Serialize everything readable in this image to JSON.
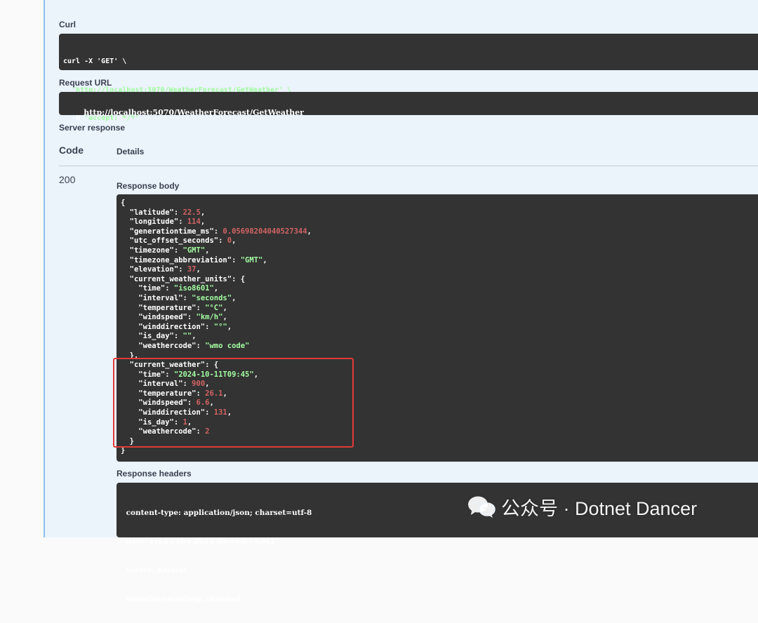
{
  "curl": {
    "label": "Curl",
    "lines": [
      "curl -X 'GET' \\",
      "  'http://localhost:5070/WeatherForecast/GetWeather' \\",
      "  -H 'accept: */*'"
    ]
  },
  "request_url": {
    "label": "Request URL",
    "value": "http://localhost:5070/WeatherForecast/GetWeather"
  },
  "server_response": {
    "label": "Server response",
    "col_code": "Code",
    "col_details": "Details",
    "status_code": "200",
    "body_label": "Response body",
    "body_lines": [
      [
        [
          "p",
          "{"
        ]
      ],
      [
        [
          "p",
          "  "
        ],
        [
          "k",
          "\"latitude\""
        ],
        [
          "p",
          ": "
        ],
        [
          "n",
          "22.5"
        ],
        [
          "p",
          ","
        ]
      ],
      [
        [
          "p",
          "  "
        ],
        [
          "k",
          "\"longitude\""
        ],
        [
          "p",
          ": "
        ],
        [
          "n",
          "114"
        ],
        [
          "p",
          ","
        ]
      ],
      [
        [
          "p",
          "  "
        ],
        [
          "k",
          "\"generationtime_ms\""
        ],
        [
          "p",
          ": "
        ],
        [
          "n",
          "0.05698204040527344"
        ],
        [
          "p",
          ","
        ]
      ],
      [
        [
          "p",
          "  "
        ],
        [
          "k",
          "\"utc_offset_seconds\""
        ],
        [
          "p",
          ": "
        ],
        [
          "n",
          "0"
        ],
        [
          "p",
          ","
        ]
      ],
      [
        [
          "p",
          "  "
        ],
        [
          "k",
          "\"timezone\""
        ],
        [
          "p",
          ": "
        ],
        [
          "s",
          "\"GMT\""
        ],
        [
          "p",
          ","
        ]
      ],
      [
        [
          "p",
          "  "
        ],
        [
          "k",
          "\"timezone_abbreviation\""
        ],
        [
          "p",
          ": "
        ],
        [
          "s",
          "\"GMT\""
        ],
        [
          "p",
          ","
        ]
      ],
      [
        [
          "p",
          "  "
        ],
        [
          "k",
          "\"elevation\""
        ],
        [
          "p",
          ": "
        ],
        [
          "n",
          "37"
        ],
        [
          "p",
          ","
        ]
      ],
      [
        [
          "p",
          "  "
        ],
        [
          "k",
          "\"current_weather_units\""
        ],
        [
          "p",
          ": {"
        ]
      ],
      [
        [
          "p",
          "    "
        ],
        [
          "k",
          "\"time\""
        ],
        [
          "p",
          ": "
        ],
        [
          "s",
          "\"iso8601\""
        ],
        [
          "p",
          ","
        ]
      ],
      [
        [
          "p",
          "    "
        ],
        [
          "k",
          "\"interval\""
        ],
        [
          "p",
          ": "
        ],
        [
          "s",
          "\"seconds\""
        ],
        [
          "p",
          ","
        ]
      ],
      [
        [
          "p",
          "    "
        ],
        [
          "k",
          "\"temperature\""
        ],
        [
          "p",
          ": "
        ],
        [
          "s",
          "\"°C\""
        ],
        [
          "p",
          ","
        ]
      ],
      [
        [
          "p",
          "    "
        ],
        [
          "k",
          "\"windspeed\""
        ],
        [
          "p",
          ": "
        ],
        [
          "s",
          "\"km/h\""
        ],
        [
          "p",
          ","
        ]
      ],
      [
        [
          "p",
          "    "
        ],
        [
          "k",
          "\"winddirection\""
        ],
        [
          "p",
          ": "
        ],
        [
          "s",
          "\"°\""
        ],
        [
          "p",
          ","
        ]
      ],
      [
        [
          "p",
          "    "
        ],
        [
          "k",
          "\"is_day\""
        ],
        [
          "p",
          ": "
        ],
        [
          "s",
          "\"\""
        ],
        [
          "p",
          ","
        ]
      ],
      [
        [
          "p",
          "    "
        ],
        [
          "k",
          "\"weathercode\""
        ],
        [
          "p",
          ": "
        ],
        [
          "s",
          "\"wmo code\""
        ]
      ],
      [
        [
          "p",
          "  },"
        ]
      ],
      [
        [
          "p",
          "  "
        ],
        [
          "k",
          "\"current_weather\""
        ],
        [
          "p",
          ": {"
        ]
      ],
      [
        [
          "p",
          "    "
        ],
        [
          "k",
          "\"time\""
        ],
        [
          "p",
          ": "
        ],
        [
          "s",
          "\"2024-10-11T09:45\""
        ],
        [
          "p",
          ","
        ]
      ],
      [
        [
          "p",
          "    "
        ],
        [
          "k",
          "\"interval\""
        ],
        [
          "p",
          ": "
        ],
        [
          "n",
          "900"
        ],
        [
          "p",
          ","
        ]
      ],
      [
        [
          "p",
          "    "
        ],
        [
          "k",
          "\"temperature\""
        ],
        [
          "p",
          ": "
        ],
        [
          "n",
          "26.1"
        ],
        [
          "p",
          ","
        ]
      ],
      [
        [
          "p",
          "    "
        ],
        [
          "k",
          "\"windspeed\""
        ],
        [
          "p",
          ": "
        ],
        [
          "n",
          "6.6"
        ],
        [
          "p",
          ","
        ]
      ],
      [
        [
          "p",
          "    "
        ],
        [
          "k",
          "\"winddirection\""
        ],
        [
          "p",
          ": "
        ],
        [
          "n",
          "131"
        ],
        [
          "p",
          ","
        ]
      ],
      [
        [
          "p",
          "    "
        ],
        [
          "k",
          "\"is_day\""
        ],
        [
          "p",
          ": "
        ],
        [
          "n",
          "1"
        ],
        [
          "p",
          ","
        ]
      ],
      [
        [
          "p",
          "    "
        ],
        [
          "k",
          "\"weathercode\""
        ],
        [
          "p",
          ": "
        ],
        [
          "n",
          "2"
        ]
      ],
      [
        [
          "p",
          "  }"
        ]
      ],
      [
        [
          "p",
          "}"
        ]
      ]
    ],
    "headers_label": "Response headers",
    "header_lines": [
      " content-type: application/json; charset=utf-8 ",
      " date: Fri,11 Oct 2024 09:56:07 GMT ",
      " server: Kestrel ",
      " transfer-encoding: chunked "
    ]
  },
  "watermark": {
    "text": "公众号 · Dotnet Dancer",
    "icon": "wechat-icon"
  },
  "colors": {
    "panel_bg": "#ebf3fb",
    "code_bg": "#333333",
    "string": "#a2fca2",
    "number": "#d36363",
    "highlight": "#e23a3a"
  }
}
